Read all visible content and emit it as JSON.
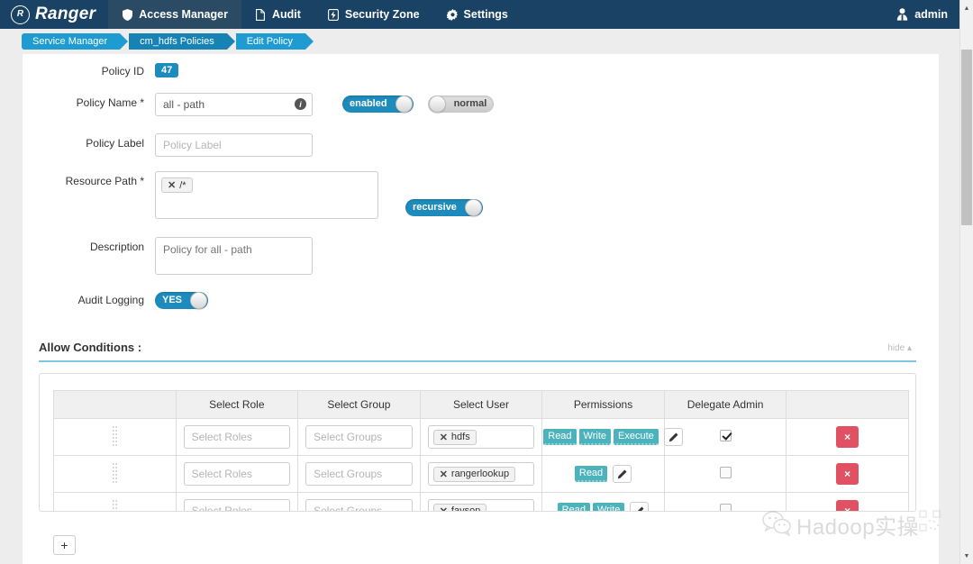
{
  "nav": {
    "brand": "Ranger",
    "brand_mark": "R",
    "items": [
      {
        "label": "Access Manager",
        "icon": "shield-icon",
        "active": true
      },
      {
        "label": "Audit",
        "icon": "file-icon",
        "active": false
      },
      {
        "label": "Security Zone",
        "icon": "bolt-icon",
        "active": false
      },
      {
        "label": "Settings",
        "icon": "gear-icon",
        "active": false
      }
    ],
    "user": {
      "label": "admin",
      "icon": "user-icon"
    }
  },
  "breadcrumb": {
    "items": [
      "Service Manager",
      "cm_hdfs Policies",
      "Edit Policy"
    ]
  },
  "form": {
    "policy_id": {
      "label": "Policy ID",
      "value": "47"
    },
    "policy_name": {
      "label": "Policy Name *",
      "value": "all - path",
      "info_icon": "info-icon"
    },
    "status_toggle": {
      "label": "enabled",
      "state": "on"
    },
    "type_toggle": {
      "label": "normal",
      "state": "off"
    },
    "policy_label": {
      "label": "Policy Label",
      "placeholder": "Policy Label",
      "value": ""
    },
    "resource_path": {
      "label": "Resource Path *",
      "tags": [
        "/*"
      ]
    },
    "recursive_toggle": {
      "label": "recursive",
      "state": "on"
    },
    "description": {
      "label": "Description",
      "placeholder": "Policy for all - path",
      "value": ""
    },
    "audit_logging": {
      "label": "Audit Logging",
      "toggle_label": "YES",
      "state": "on"
    }
  },
  "allow_conditions": {
    "title": "Allow Conditions :",
    "hide_label": "hide",
    "columns": [
      "Select Role",
      "Select Group",
      "Select User",
      "Permissions",
      "Delegate Admin"
    ],
    "role_placeholder": "Select Roles",
    "group_placeholder": "Select Groups",
    "rows": [
      {
        "role": "",
        "group": "",
        "users": [
          "hdfs"
        ],
        "permissions": [
          "Read",
          "Write",
          "Execute"
        ],
        "delegate_admin": true
      },
      {
        "role": "",
        "group": "",
        "users": [
          "rangerlookup"
        ],
        "permissions": [
          "Read"
        ],
        "delegate_admin": false
      },
      {
        "role": "",
        "group": "",
        "users": [
          "fayson"
        ],
        "permissions": [
          "Read",
          "Write"
        ],
        "delegate_admin": false
      }
    ],
    "add_button": "+",
    "delete_button": "×",
    "edit_icon": "pencil-icon",
    "drag_icon": "drag-handle-icon"
  },
  "watermark": {
    "text": "Hadoop实操",
    "icon": "wechat-icon"
  },
  "colors": {
    "nav_bg": "#194264",
    "nav_active": "#2b4a63",
    "crumb": "#1e9bd0",
    "crumb_mid": "#1783b5",
    "accent": "#1e8bbd",
    "permission": "#4cb3bd",
    "danger": "#e05263",
    "rule": "#7fc6e4",
    "page_bg": "#ededed"
  }
}
